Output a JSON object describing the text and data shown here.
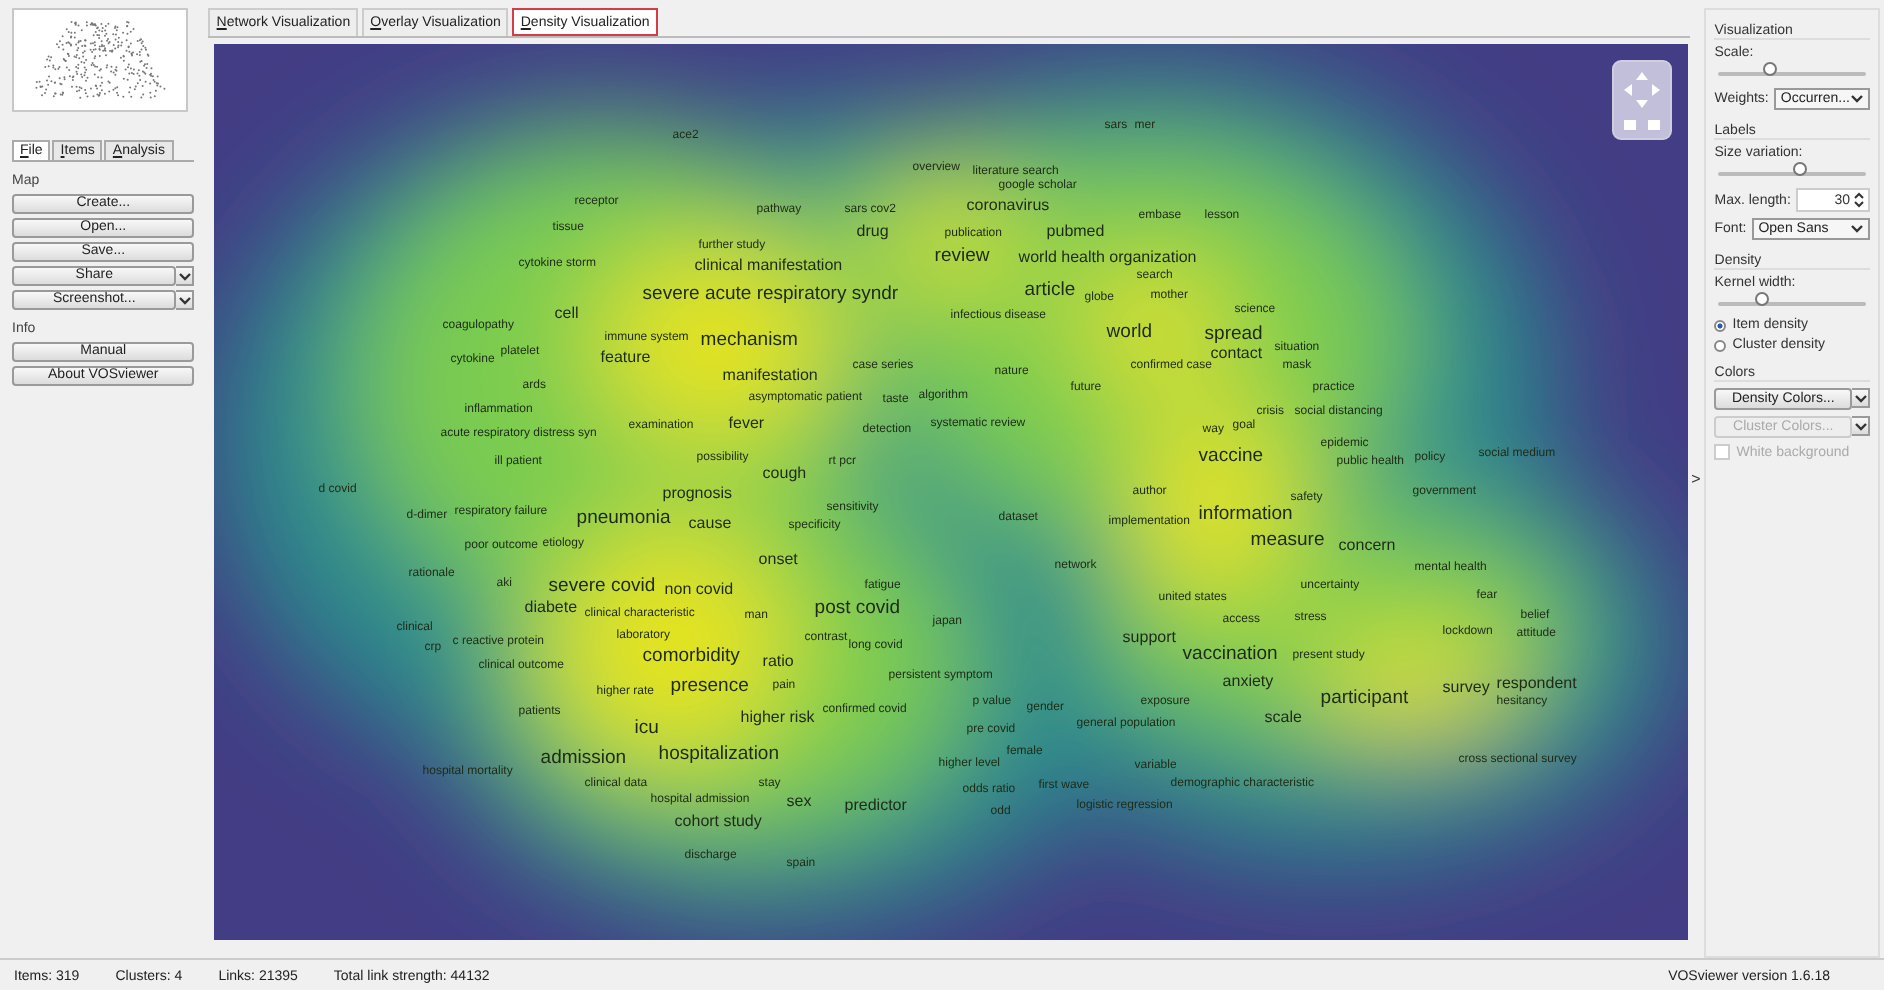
{
  "side_tabs": [
    {
      "label": "File",
      "selected": true
    },
    {
      "label": "Items",
      "selected": false
    },
    {
      "label": "Analysis",
      "selected": false
    }
  ],
  "groups": [
    {
      "title": "Map",
      "buttons": [
        {
          "label": "Create...",
          "dropdown": false
        },
        {
          "label": "Open...",
          "dropdown": false
        },
        {
          "label": "Save...",
          "dropdown": false
        },
        {
          "label": "Share",
          "dropdown": true
        },
        {
          "label": "Screenshot...",
          "dropdown": true
        }
      ]
    },
    {
      "title": "Info",
      "buttons": [
        {
          "label": "Manual",
          "dropdown": false
        },
        {
          "label": "About VOSviewer",
          "dropdown": false
        }
      ]
    }
  ],
  "view_tabs": [
    {
      "label": "Network Visualization",
      "selected": false
    },
    {
      "label": "Overlay Visualization",
      "selected": false
    },
    {
      "label": "Density Visualization",
      "selected": true
    }
  ],
  "map": {
    "terms": [
      "ace2",
      "overview",
      "literature search",
      "receptor",
      "pathway",
      "sars cov2",
      "tissue",
      "drug",
      "further study",
      "cytokine storm",
      "clinical manifestation",
      "severe acute respiratory syndr",
      "coagulopathy",
      "cell",
      "immune system",
      "mechanism",
      "cytokine",
      "platelet",
      "feature",
      "ards",
      "manifestation",
      "case series",
      "asymptomatic patient",
      "taste",
      "inflammation",
      "examination",
      "fever",
      "detection",
      "acute respiratory distress syn",
      "ill patient",
      "possibility",
      "cough",
      "rt pcr",
      "sars",
      "mer",
      "google scholar",
      "coronavirus",
      "embase",
      "lesson",
      "publication",
      "pubmed",
      "review",
      "world health organization",
      "search",
      "article",
      "globe",
      "mother",
      "infectious disease",
      "science",
      "world",
      "spread",
      "contact",
      "situation",
      "confirmed case",
      "mask",
      "nature",
      "future",
      "algorithm",
      "practice",
      "systematic review",
      "crisis",
      "social distancing",
      "way",
      "goal",
      "epidemic",
      "vaccine",
      "public health",
      "policy",
      "social medium",
      "d covid",
      "prognosis",
      "d-dimer",
      "respiratory failure",
      "pneumonia",
      "cause",
      "sensitivity",
      "specificity",
      "poor outcome",
      "etiology",
      "onset",
      "rationale",
      "aki",
      "severe covid",
      "non covid",
      "fatigue",
      "diabete",
      "clinical characteristic",
      "man",
      "post covid",
      "clinical",
      "japan",
      "crp",
      "c reactive protein",
      "laboratory",
      "comorbidity",
      "ratio",
      "contrast",
      "long covid",
      "clinical outcome",
      "persistent symptom",
      "higher rate",
      "presence",
      "pain",
      "patients",
      "higher risk",
      "confirmed covid",
      "icu",
      "admission",
      "hospitalization",
      "hospital mortality",
      "clinical data",
      "stay",
      "hospital admission",
      "sex",
      "predictor",
      "cohort study",
      "discharge",
      "spain",
      "author",
      "safety",
      "government",
      "dataset",
      "implementation",
      "information",
      "measure",
      "concern",
      "network",
      "mental health",
      "uncertainty",
      "united states",
      "fear",
      "access",
      "stress",
      "belief",
      "lockdown",
      "attitude",
      "support",
      "vaccination",
      "present study",
      "anxiety",
      "survey",
      "respondent",
      "p value",
      "gender",
      "exposure",
      "participant",
      "hesitancy",
      "scale",
      "general population",
      "pre covid",
      "female",
      "higher level",
      "variable",
      "cross sectional survey",
      "odds ratio",
      "first wave",
      "demographic characteristic",
      "logistic regression",
      "odd"
    ]
  },
  "collapse_glyph": ">",
  "settings": {
    "visualization": {
      "title": "Visualization",
      "scale_label": "Scale:",
      "scale": {
        "level": 0.35
      },
      "weights_label": "Weights:",
      "weights_value": "Occurren..."
    },
    "labels": {
      "title": "Labels",
      "size_label": "Size variation:",
      "size_variation": {
        "level": 0.55
      },
      "max_length_label": "Max. length:",
      "max_length": "30",
      "font_label": "Font:",
      "font_value": "Open Sans"
    },
    "density": {
      "title": "Density",
      "kernel_label": "Kernel width:",
      "kernel_width": {
        "level": 0.3
      },
      "options": [
        {
          "label": "Item density",
          "selected": true
        },
        {
          "label": "Cluster density",
          "selected": false
        }
      ]
    },
    "colors": {
      "title": "Colors",
      "buttons": [
        {
          "label": "Density Colors...",
          "disabled": false
        },
        {
          "label": "Cluster Colors...",
          "disabled": true
        }
      ],
      "white_background": {
        "label": "White background",
        "checked": false,
        "disabled": true
      }
    }
  },
  "status_bar": [
    {
      "label": "Items:",
      "value": "319"
    },
    {
      "label": "Clusters:",
      "value": "4"
    },
    {
      "label": "Links:",
      "value": "21395"
    },
    {
      "label": "Total link strength:",
      "value": "44132"
    }
  ],
  "version": "VOSviewer version 1.6.18"
}
